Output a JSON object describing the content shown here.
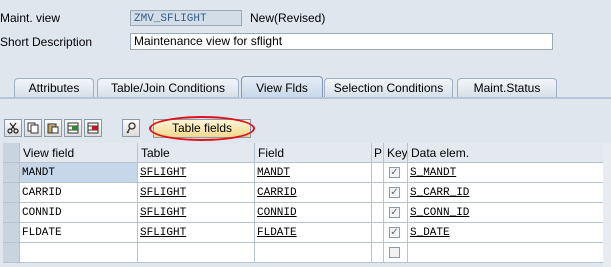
{
  "header": {
    "maint_view_label": "Maint. view",
    "maint_view_value": "ZMV_SFLIGHT",
    "status": "New(Revised)",
    "short_desc_label": "Short Description",
    "short_desc_value": "Maintenance view for sflight"
  },
  "tabs": [
    {
      "label": "Attributes",
      "active": false
    },
    {
      "label": "Table/Join Conditions",
      "active": false
    },
    {
      "label": "View Flds",
      "active": true
    },
    {
      "label": "Selection Conditions",
      "active": false
    },
    {
      "label": "Maint.Status",
      "active": false
    }
  ],
  "toolbar": {
    "icons": [
      "cut-icon",
      "copy-icon",
      "paste-icon",
      "insert-row-icon",
      "delete-row-icon",
      "lock-key-icon"
    ],
    "table_fields_label": "Table fields"
  },
  "grid": {
    "columns": [
      "View field",
      "Table",
      "Field",
      "P",
      "Key",
      "Data elem."
    ],
    "rows": [
      {
        "view_field": "MANDT",
        "table": "SFLIGHT",
        "field": "MANDT",
        "p": "",
        "key": true,
        "data_elem": "S_MANDT"
      },
      {
        "view_field": "CARRID",
        "table": "SFLIGHT",
        "field": "CARRID",
        "p": "",
        "key": true,
        "data_elem": "S_CARR_ID"
      },
      {
        "view_field": "CONNID",
        "table": "SFLIGHT",
        "field": "CONNID",
        "p": "",
        "key": true,
        "data_elem": "S_CONN_ID"
      },
      {
        "view_field": "FLDATE",
        "table": "SFLIGHT",
        "field": "FLDATE",
        "p": "",
        "key": true,
        "data_elem": "S_DATE"
      },
      {
        "view_field": "",
        "table": "",
        "field": "",
        "p": "",
        "key": false,
        "data_elem": ""
      }
    ]
  },
  "colors": {
    "background": "#dfe6ee",
    "highlight_circle": "#e0101a",
    "code_text": "#355e8a"
  }
}
